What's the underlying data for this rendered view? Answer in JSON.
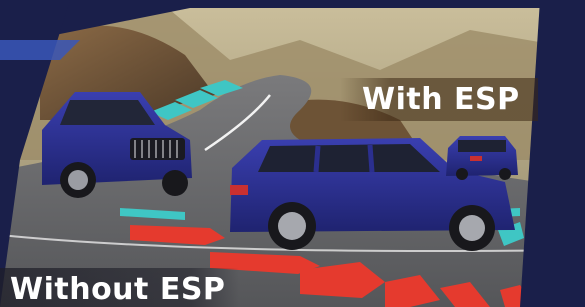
{
  "banner": {
    "with_esp_label": "With ESP",
    "without_esp_label": "Without ESP"
  },
  "colors": {
    "frame_navy": "#1a1f4a",
    "car_blue": "#2b2f8f",
    "with_esp_arrow": "#3fc6c4",
    "without_esp_arrow": "#e53a2e",
    "road": "#6b6c70",
    "sky": "#b9aa86"
  },
  "icons": {
    "with_esp_path": "cyan-chevron-trail-icon",
    "without_esp_path": "red-chevron-trail-icon"
  }
}
